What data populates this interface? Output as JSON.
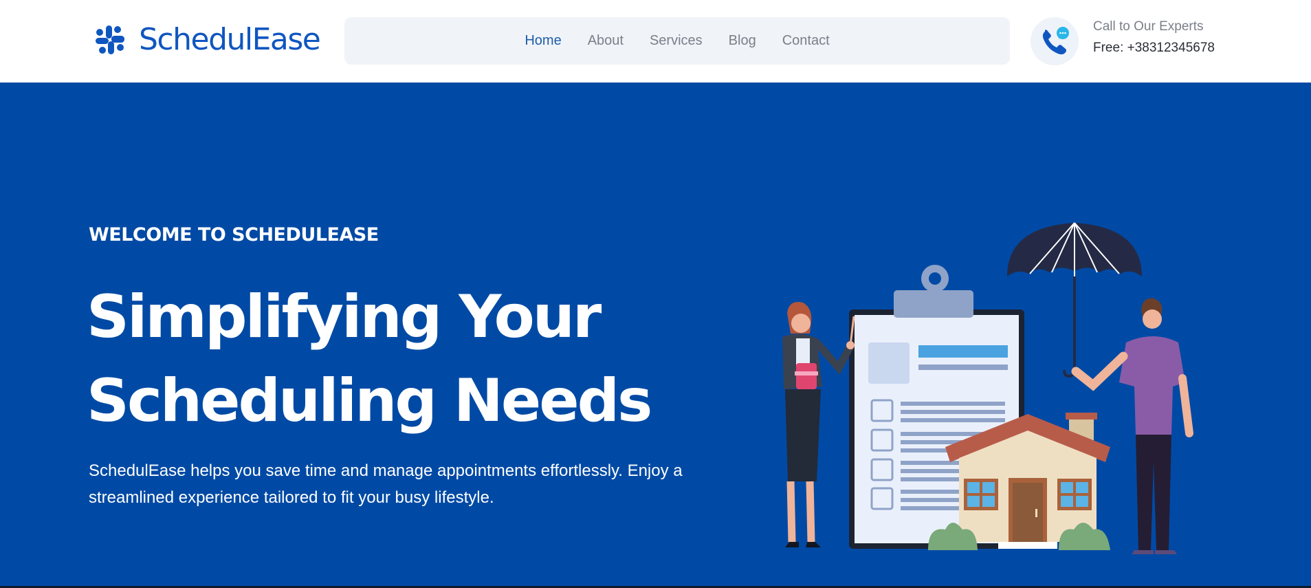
{
  "brand": {
    "name": "SchedulEase"
  },
  "nav": {
    "items": [
      {
        "label": "Home",
        "active": true
      },
      {
        "label": "About",
        "active": false
      },
      {
        "label": "Services",
        "active": false
      },
      {
        "label": "Blog",
        "active": false
      },
      {
        "label": "Contact",
        "active": false
      }
    ]
  },
  "contact": {
    "label": "Call to Our Experts",
    "phone": "Free: +38312345678"
  },
  "hero": {
    "eyebrow": "WELCOME TO SCHEDULEASE",
    "headline_line1": "Simplifying Your",
    "headline_line2": "Scheduling Needs",
    "description_line1": "SchedulEase helps you save time and manage appointments effortlessly. Enjoy a",
    "description_line2": "streamlined experience tailored to fit your busy lifestyle."
  },
  "colors": {
    "brand_blue": "#0f56c0",
    "hero_bg": "#004aa5",
    "nav_bg": "#f0f3f8",
    "nav_active": "#1e5ea8",
    "nav_text": "#7a7f88"
  },
  "icons": {
    "logo": "slack-like-logo-icon",
    "phone": "phone-chat-icon"
  }
}
